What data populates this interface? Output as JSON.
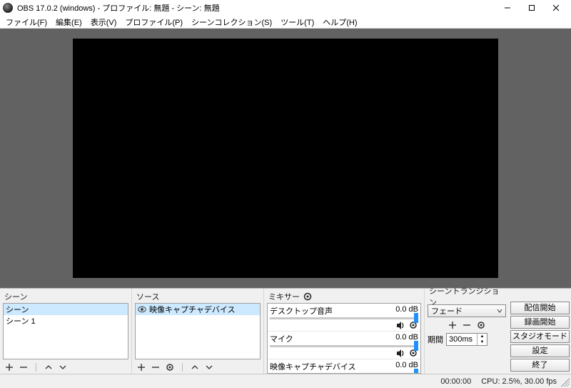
{
  "window": {
    "title": "OBS 17.0.2 (windows) - プロファイル: 無題 - シーン: 無題"
  },
  "menu": {
    "file": "ファイル(F)",
    "edit": "編集(E)",
    "view": "表示(V)",
    "profile": "プロファイル(P)",
    "scene_collection": "シーンコレクション(S)",
    "tools": "ツール(T)",
    "help": "ヘルプ(H)"
  },
  "panels": {
    "scenes": {
      "title": "シーン",
      "items": [
        "シーン",
        "シーン 1"
      ]
    },
    "sources": {
      "title": "ソース",
      "items": [
        {
          "label": "映像キャプチャデバイス",
          "visible": true
        }
      ]
    },
    "mixer": {
      "title": "ミキサー",
      "items": [
        {
          "name": "デスクトップ音声",
          "db": "0.0 dB"
        },
        {
          "name": "マイク",
          "db": "0.0 dB"
        },
        {
          "name": "映像キャプチャデバイス",
          "db": "0.0 dB"
        }
      ]
    },
    "transitions": {
      "title": "シーントランジション",
      "selected": "フェード",
      "duration_label": "期間",
      "duration_value": "300ms"
    },
    "controls": {
      "stream": "配信開始",
      "record": "録画開始",
      "studio": "スタジオモード",
      "settings": "設定",
      "exit": "終了"
    }
  },
  "status": {
    "time": "00:00:00",
    "cpu": "CPU: 2.5%, 30.00 fps"
  }
}
